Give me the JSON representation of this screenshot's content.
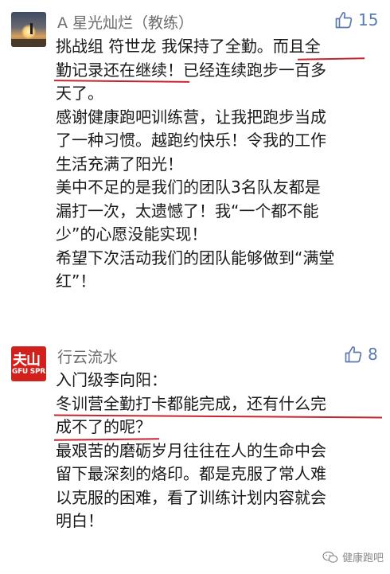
{
  "comments": [
    {
      "author": "A 星光灿烂（教练）",
      "likes": "15",
      "avatar_text": "",
      "lines": [
        "挑战组 符世龙 我保持了全勤。而且全",
        "勤记录还在继续！已经连续跑步一百多",
        "天了。",
        "感谢健康跑吧训练营，让我把跑步当成",
        "了一种习惯。越跑约快乐！令我的工作",
        "生活充满了阳光！",
        "美中不足的是我们的团队3名队友都是",
        "漏打一次，太遗憾了！我“一个都不能",
        "少”的心愿没能实现！",
        "希望下次活动我们的团队能够做到“满堂",
        "红”！"
      ]
    },
    {
      "author": "行云流水",
      "likes": "8",
      "avatar_text": "夫山",
      "avatar_subtext": "GFU SPR",
      "lines": [
        "入门级李向阳：",
        "冬训营全勤打卡都能完成，还有什么完",
        "成不了的呢？",
        "最艰苦的磨砺岁月往往在人的生命中会",
        "留下最深刻的烙印。都是克服了常人难",
        "以克服的困难，看了训练计划内容就会",
        "明白！"
      ]
    }
  ],
  "watermark": "健康跑吧",
  "colors": {
    "underline": "#c4262e",
    "like": "#5b7ab0",
    "text": "#1a1a1a",
    "name": "#6c6c6c"
  },
  "icons": {
    "like": "thumbs-up-icon",
    "watermark": "wechat-icon"
  }
}
